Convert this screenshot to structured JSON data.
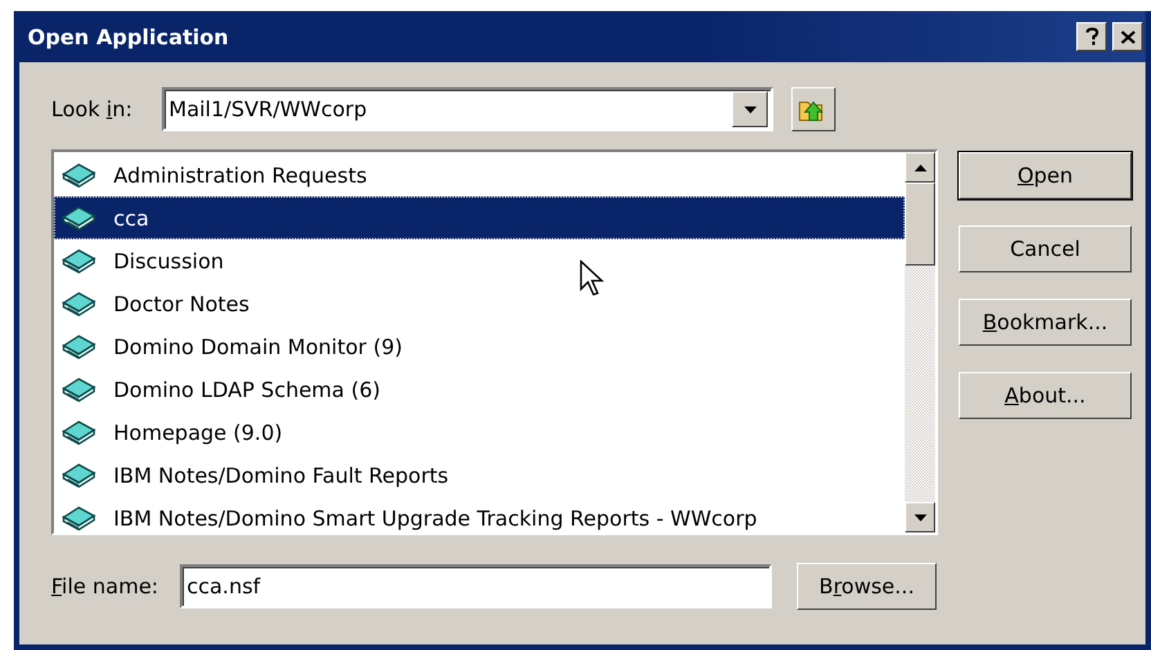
{
  "window": {
    "title": "Open Application"
  },
  "look_in": {
    "label": {
      "pre": "Look ",
      "key": "i",
      "post": "n:"
    },
    "value": "Mail1/SVR/WWcorp"
  },
  "databases": [
    {
      "name": "Administration Requests",
      "selected": false
    },
    {
      "name": "cca",
      "selected": true
    },
    {
      "name": "Discussion",
      "selected": false
    },
    {
      "name": "Doctor Notes",
      "selected": false
    },
    {
      "name": "Domino Domain Monitor (9)",
      "selected": false
    },
    {
      "name": "Domino LDAP Schema (6)",
      "selected": false
    },
    {
      "name": "Homepage (9.0)",
      "selected": false
    },
    {
      "name": "IBM Notes/Domino Fault Reports",
      "selected": false
    },
    {
      "name": "IBM Notes/Domino Smart Upgrade Tracking Reports - WWcorp",
      "selected": false
    }
  ],
  "buttons": [
    {
      "key": "O",
      "post": "pen",
      "default": true
    },
    {
      "pre": "Cancel",
      "default": false
    },
    {
      "key": "B",
      "post": "ookmark...",
      "default": false
    },
    {
      "key": "A",
      "post": "bout...",
      "default": false
    }
  ],
  "file_name": {
    "label": {
      "key": "F",
      "post": "ile name:"
    },
    "value": "cca.nsf"
  },
  "browse_button": {
    "pre": "B",
    "key": "r",
    "post": "owse..."
  }
}
